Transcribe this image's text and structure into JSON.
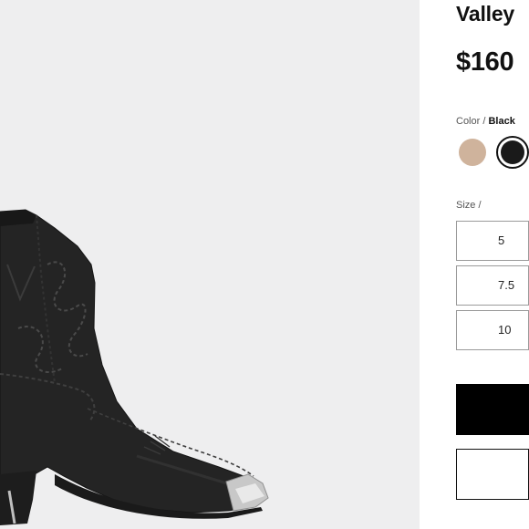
{
  "product": {
    "title": "Valley",
    "price": "$160"
  },
  "color": {
    "label": "Color",
    "separator": " / ",
    "selected": "Black",
    "swatches": [
      {
        "name": "tan",
        "hex": "#cfb39c"
      },
      {
        "name": "black",
        "hex": "#1a1a1a",
        "selected": true
      }
    ]
  },
  "size": {
    "label": "Size",
    "separator": " /",
    "options": [
      "5",
      "7.5",
      "10"
    ]
  },
  "image": {
    "subject": "black-western-ankle-boot-icon"
  },
  "colors": {
    "gallery_bg": "#eeeeef",
    "accent": "#000000"
  }
}
